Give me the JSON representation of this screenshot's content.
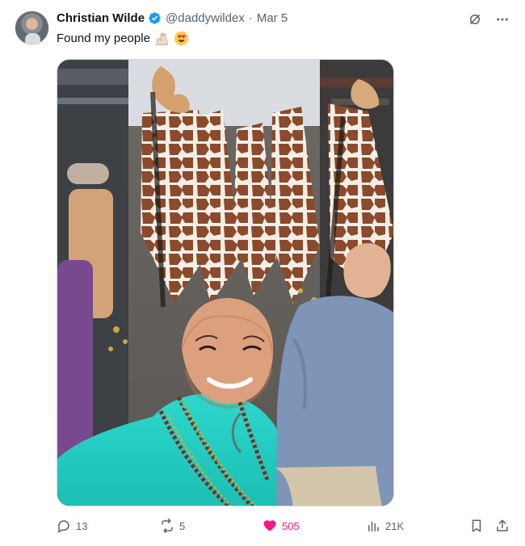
{
  "post": {
    "author_name": "Christian Wilde",
    "handle": "@daddywildex",
    "separator": "·",
    "date": "Mar 5",
    "text": "Found my people",
    "media_alt": "Selfie at a parade with people in giraffe costumes"
  },
  "metrics": {
    "replies": "13",
    "reposts": "5",
    "likes": "505",
    "views": "21K"
  },
  "icons": {
    "verified": "verified-badge-icon",
    "grok": "grok-icon",
    "more": "more-icon",
    "reply": "reply-icon",
    "repost": "repost-icon",
    "like": "heart-icon",
    "views": "views-icon",
    "bookmark": "bookmark-icon",
    "share": "share-icon"
  },
  "colors": {
    "like": "#f91880",
    "verified": "#1d9bf0",
    "secondary_text": "#536471"
  }
}
